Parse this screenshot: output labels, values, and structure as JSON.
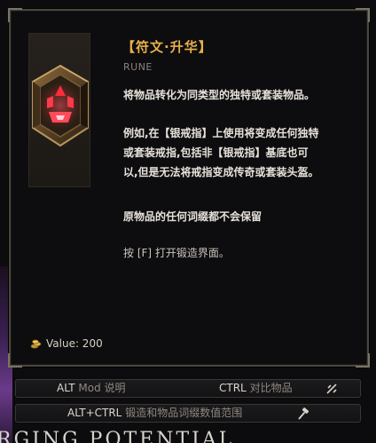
{
  "tooltip": {
    "title": "【符文·升华】",
    "category": "RUNE",
    "description": [
      "将物品转化为同类型的独特或套装物品。",
      "例如,在【银戒指】上使用将变成任何独特",
      "或套装戒指,包括非【银戒指】基底也可",
      "以,但是无法将戒指变成传奇或套装头盔。",
      "原物品的任何词缀都不会保留"
    ],
    "hint": "按 [F] 打开锻造界面。",
    "value_label": "Value: 200",
    "icon": "rune-of-ascendance-icon"
  },
  "keybinds": {
    "alt_key": "ALT",
    "alt_action": "Mod 说明",
    "ctrl_key": "CTRL",
    "ctrl_action": "对比物品",
    "altctrl_key": "ALT+CTRL",
    "altctrl_action": "锻造和物品词缀数值范围"
  },
  "background": {
    "bottom_text": "RGING POTENTIAL"
  },
  "colors": {
    "title": "#e8b04a",
    "rune_glow": "#e8283c",
    "border": "#4a463e"
  }
}
